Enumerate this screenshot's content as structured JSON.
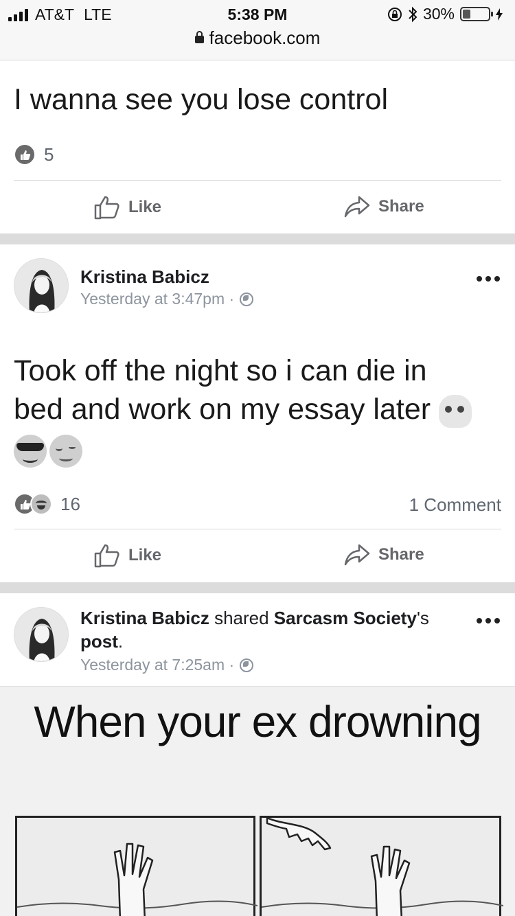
{
  "status_bar": {
    "carrier": "AT&T",
    "network": "LTE",
    "time": "5:38 PM",
    "battery_percent": "30%",
    "battery_level": 0.3,
    "url": "facebook.com"
  },
  "top_post": {
    "text": "I wanna see you lose control",
    "reaction_count": "5",
    "like_label": "Like",
    "share_label": "Share"
  },
  "post2": {
    "author": "Kristina Babicz",
    "timestamp": "Yesterday at 3:47pm ·",
    "text_line1": "Took off the night so i can die in",
    "text_line2": "bed and work on my essay later",
    "reaction_count": "16",
    "comments": "1 Comment",
    "like_label": "Like",
    "share_label": "Share"
  },
  "post3": {
    "author": "Kristina Babicz",
    "shared_word": "shared",
    "page_name": "Sarcasm Society",
    "possessive": "'s",
    "post_word": "post",
    "period": ".",
    "timestamp": "Yesterday at 7:25am ·",
    "meme_caption": "When your ex drowning"
  },
  "icons": [
    "signal-icon",
    "lock-icon",
    "rotation-lock-icon",
    "bluetooth-icon",
    "battery-icon",
    "charging-icon",
    "like-icon",
    "share-icon",
    "globe-icon",
    "more-icon",
    "skull-emoji",
    "sunglasses-emoji",
    "relieved-emoji",
    "haha-icon"
  ],
  "colors": {
    "text": "#1c1e21",
    "meta": "#8d949e",
    "action": "#65676b",
    "divider": "#dcdcdc"
  }
}
